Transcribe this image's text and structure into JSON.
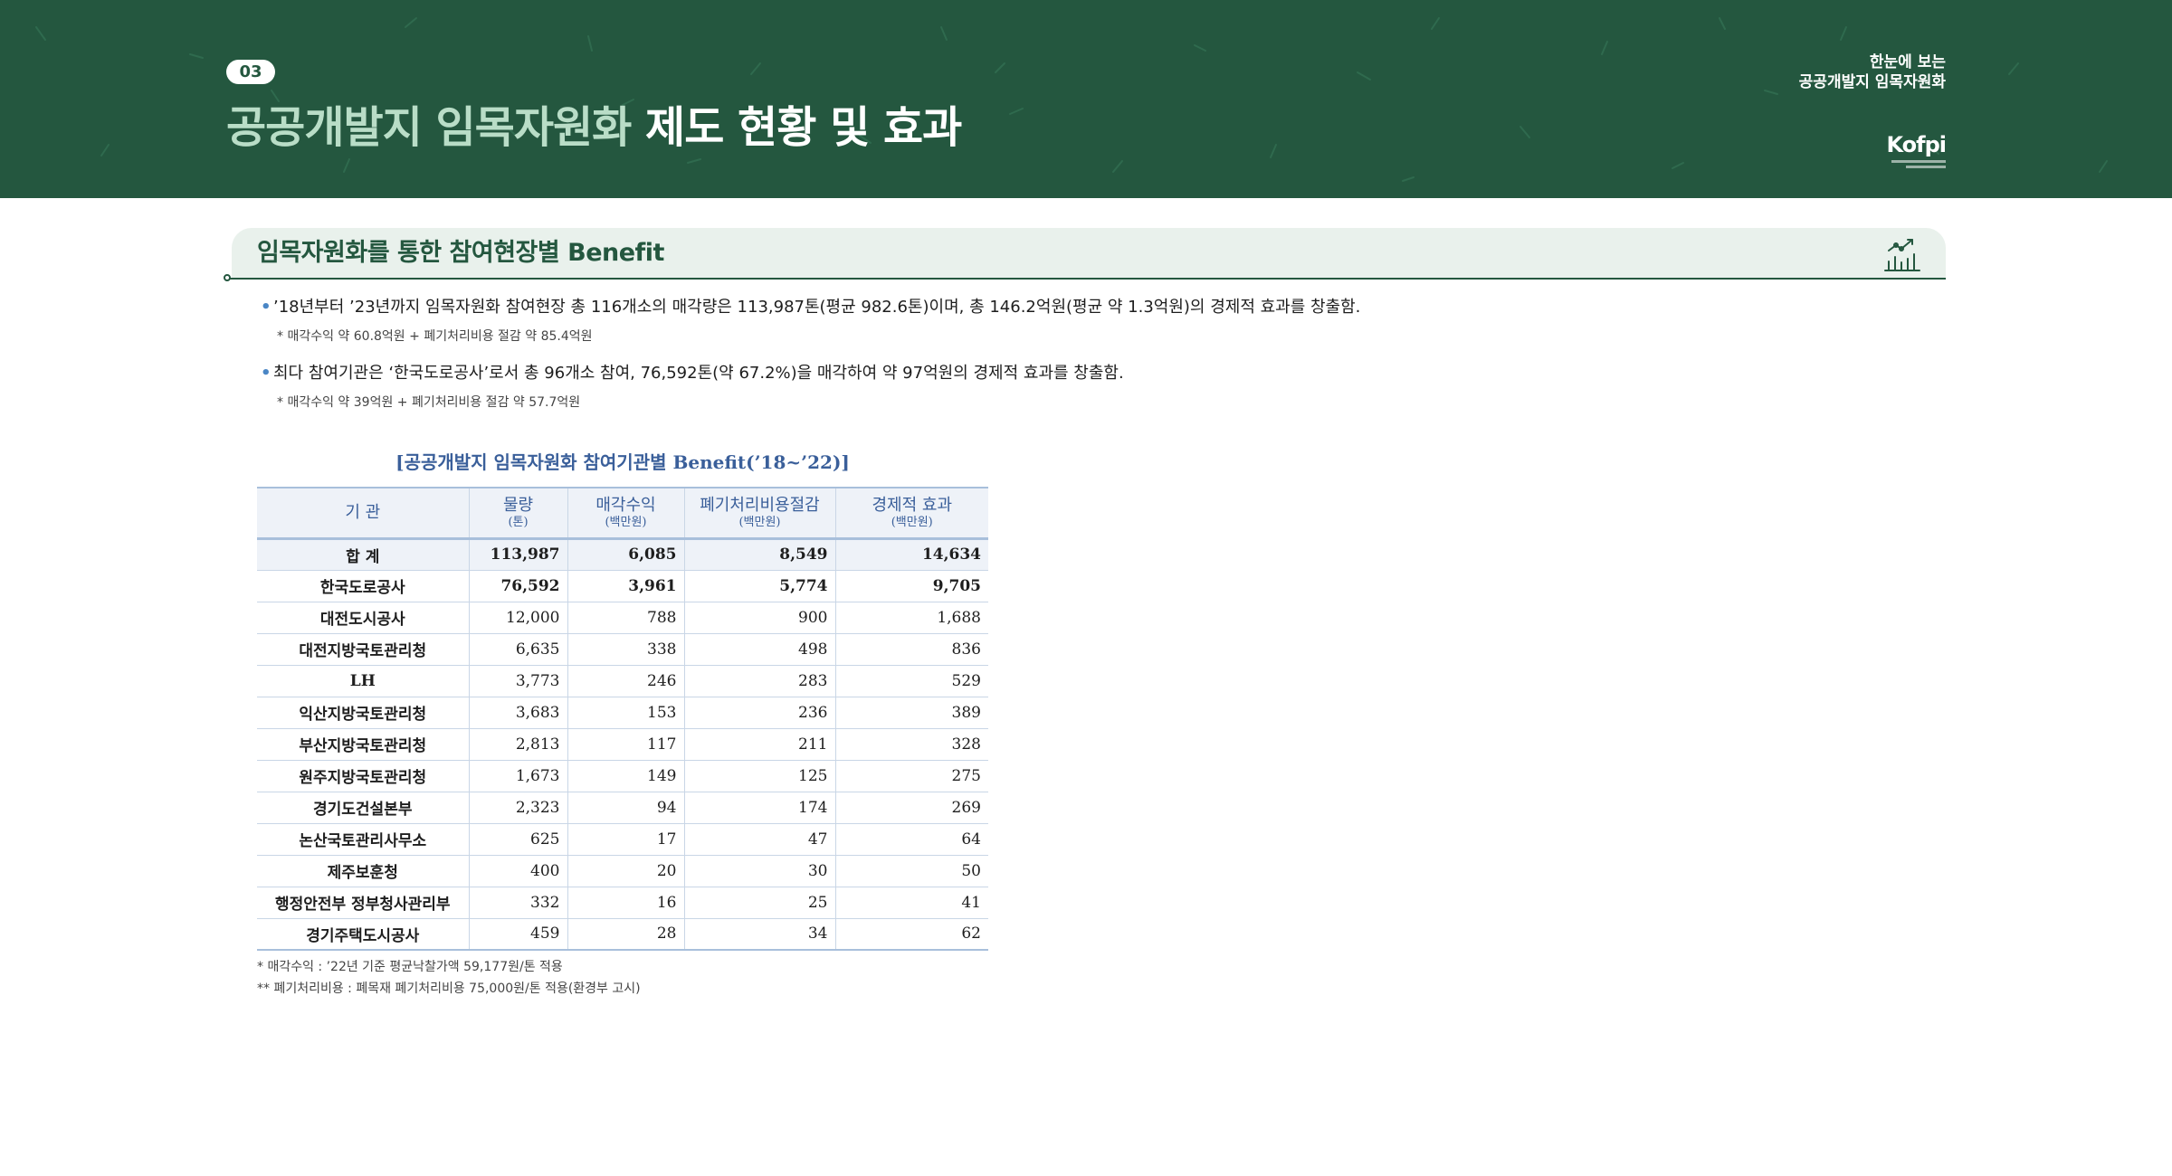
{
  "header": {
    "section_number": "03",
    "title_light": "공공개발지 임목자원화",
    "title_strong": "제도 현황 및 효과",
    "brand_caption_line1": "한눈에 보는",
    "brand_caption_line2": "공공개발지 임목자원화",
    "logo_text": "Kofpi"
  },
  "section": {
    "title": "임목자원화를 통한 참여현장별 Benefit",
    "icon": "growth-chart-icon"
  },
  "bullets": [
    {
      "text": "’18년부터 ’23년까지 임목자원화 참여현장 총 116개소의 매각량은 113,987톤(평균 982.6톤)이며, 총 146.2억원(평균 약 1.3억원)의 경제적 효과를 창출함.",
      "note": "* 매각수익 약 60.8억원 + 폐기처리비용 절감 약 85.4억원"
    },
    {
      "text": "최다 참여기관은 ‘한국도로공사’로서 총 96개소 참여, 76,592톤(약 67.2%)을 매각하여 약 97억원의 경제적 효과를 창출함.",
      "note": "* 매각수익 약 39억원 + 폐기처리비용 절감 약 57.7억원"
    }
  ],
  "table": {
    "title": "[공공개발지 임목자원화 참여기관별 Benefit(’18~’22)]",
    "headers": [
      {
        "label": "기 관",
        "unit": ""
      },
      {
        "label": "물량",
        "unit": "(톤)"
      },
      {
        "label": "매각수익",
        "unit": "(백만원)"
      },
      {
        "label": "폐기처리비용절감",
        "unit": "(백만원)"
      },
      {
        "label": "경제적 효과",
        "unit": "(백만원)"
      }
    ],
    "rows": [
      [
        "합 계",
        "113,987",
        "6,085",
        "8,549",
        "14,634"
      ],
      [
        "한국도로공사",
        "76,592",
        "3,961",
        "5,774",
        "9,705"
      ],
      [
        "대전도시공사",
        "12,000",
        "788",
        "900",
        "1,688"
      ],
      [
        "대전지방국토관리청",
        "6,635",
        "338",
        "498",
        "836"
      ],
      [
        "LH",
        "3,773",
        "246",
        "283",
        "529"
      ],
      [
        "익산지방국토관리청",
        "3,683",
        "153",
        "236",
        "389"
      ],
      [
        "부산지방국토관리청",
        "2,813",
        "117",
        "211",
        "328"
      ],
      [
        "원주지방국토관리청",
        "1,673",
        "149",
        "125",
        "275"
      ],
      [
        "경기도건설본부",
        "2,323",
        "94",
        "174",
        "269"
      ],
      [
        "논산국토관리사무소",
        "625",
        "17",
        "47",
        "64"
      ],
      [
        "제주보훈청",
        "400",
        "20",
        "30",
        "50"
      ],
      [
        "행정안전부 정부청사관리부",
        "332",
        "16",
        "25",
        "41"
      ],
      [
        "경기주택도시공사",
        "459",
        "28",
        "34",
        "62"
      ]
    ]
  },
  "footnotes": [
    "* 매각수익 : ’22년 기준 평균낙찰가액 59,177원/톤 적용",
    "** 폐기처리비용 : 폐목재 폐기처리비용 75,000원/톤 적용(환경부 고시)"
  ],
  "colors": {
    "header_green": "#24573f",
    "title_light": "#b9ddc7",
    "accent_blue": "#3a5f9a",
    "section_bg": "#e9f1ec"
  }
}
